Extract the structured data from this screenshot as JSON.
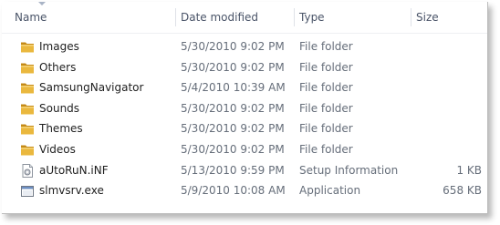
{
  "columns": {
    "name": "Name",
    "date": "Date modified",
    "type": "Type",
    "size": "Size"
  },
  "files": [
    {
      "name": "Images",
      "date": "5/30/2010 9:02 PM",
      "type": "File folder",
      "size": "",
      "icon": "folder-icon"
    },
    {
      "name": "Others",
      "date": "5/30/2010 9:02 PM",
      "type": "File folder",
      "size": "",
      "icon": "folder-icon"
    },
    {
      "name": "SamsungNavigator",
      "date": "5/4/2010 10:39 AM",
      "type": "File folder",
      "size": "",
      "icon": "folder-icon"
    },
    {
      "name": "Sounds",
      "date": "5/30/2010 9:02 PM",
      "type": "File folder",
      "size": "",
      "icon": "folder-icon"
    },
    {
      "name": "Themes",
      "date": "5/30/2010 9:02 PM",
      "type": "File folder",
      "size": "",
      "icon": "folder-icon"
    },
    {
      "name": "Videos",
      "date": "5/30/2010 9:02 PM",
      "type": "File folder",
      "size": "",
      "icon": "folder-icon"
    },
    {
      "name": "aUtoRuN.iNF",
      "date": "5/13/2010 9:59 PM",
      "type": "Setup Information",
      "size": "1 KB",
      "icon": "setup-file-icon"
    },
    {
      "name": "slmvsrv.exe",
      "date": "5/9/2010 10:08 AM",
      "type": "Application",
      "size": "658 KB",
      "icon": "application-icon"
    }
  ],
  "colors": {
    "folder": "#e8b53a",
    "folder_dark": "#c48a17",
    "header_text": "#4a5468",
    "secondary_text": "#666e7a"
  }
}
